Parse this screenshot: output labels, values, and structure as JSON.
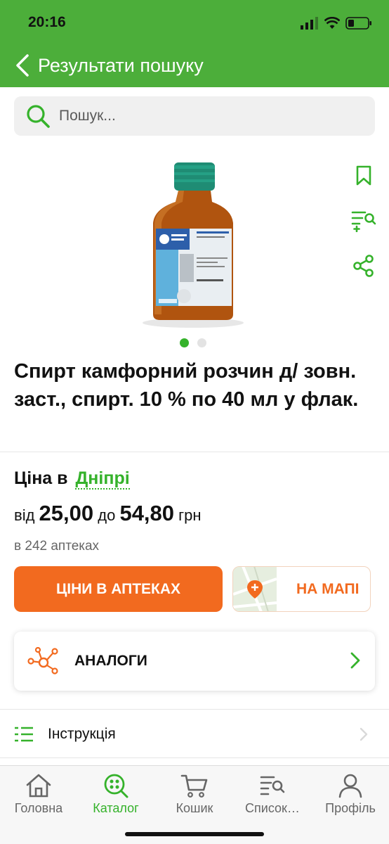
{
  "status": {
    "time": "20:16"
  },
  "nav": {
    "title": "Результати пошуку"
  },
  "search": {
    "placeholder": "Пошук..."
  },
  "product": {
    "title": "Спирт камфорний розчин д/ зовн. заст., спирт. 10 % по 40 мл у флак.",
    "images_total": 2,
    "image_active": 1
  },
  "price": {
    "label": "Ціна в",
    "city": "Дніпрі",
    "from_label": "від",
    "min": "25,00",
    "to_label": "до",
    "max": "54,80",
    "currency": "грн",
    "pharmacies": "в 242 аптеках"
  },
  "buttons": {
    "prices": "ЦІНИ В АПТЕКАХ",
    "map": "НА МАПІ"
  },
  "analogs": {
    "label": "АНАЛОГИ"
  },
  "instructions": {
    "label": "Інструкція"
  },
  "tabs": [
    {
      "label": "Головна",
      "icon": "home-icon"
    },
    {
      "label": "Каталог",
      "icon": "catalog-icon",
      "active": true
    },
    {
      "label": "Кошик",
      "icon": "cart-icon"
    },
    {
      "label": "Список…",
      "icon": "list-icon"
    },
    {
      "label": "Профіль",
      "icon": "profile-icon"
    }
  ],
  "colors": {
    "brand_green": "#4cae3a",
    "accent_orange": "#f26a1f",
    "link_green": "#35b22b"
  }
}
